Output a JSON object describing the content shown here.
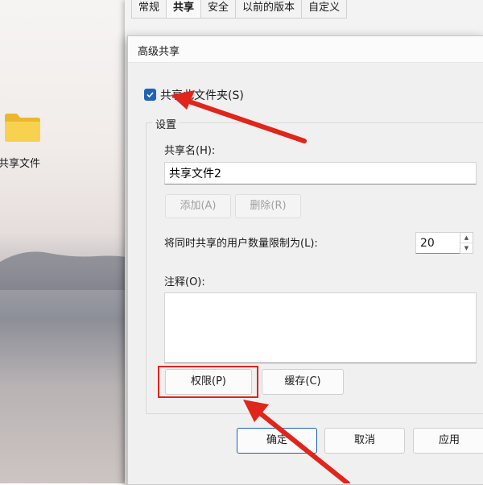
{
  "desktop": {
    "folder_label": "共享文件"
  },
  "properties": {
    "tabs": [
      "常规",
      "共享",
      "安全",
      "以前的版本",
      "自定义"
    ],
    "active_tab": "共享"
  },
  "dialog": {
    "title": "高级共享",
    "share_checkbox": {
      "label": "共享此文件夹(S)",
      "checked": true
    },
    "settings_group": "设置",
    "share_name_label": "共享名(H):",
    "share_name_value": "共享文件2",
    "add_button": "添加(A)",
    "remove_button": "删除(R)",
    "limit_label": "将同时共享的用户数量限制为(L):",
    "limit_value": "20",
    "comment_label": "注释(O):",
    "comment_value": "",
    "permissions_button": "权限(P)",
    "caching_button": "缓存(C)",
    "ok_button": "确定",
    "cancel_button": "取消",
    "apply_button": "应用"
  },
  "colors": {
    "accent": "#1e63b8",
    "highlight_red": "#e0251b"
  }
}
